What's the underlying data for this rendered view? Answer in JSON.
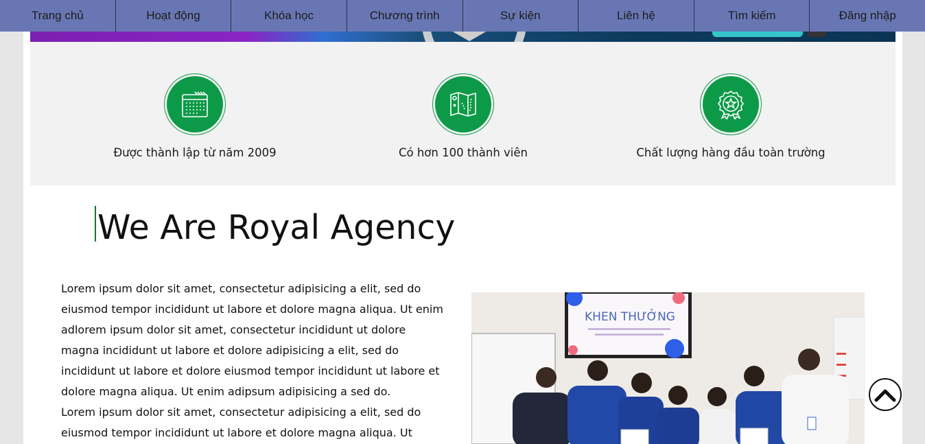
{
  "nav": {
    "items": [
      {
        "label": "Trang chủ"
      },
      {
        "label": "Hoạt động"
      },
      {
        "label": "Khóa học"
      },
      {
        "label": "Chương trình"
      },
      {
        "label": "Sự kiện"
      },
      {
        "label": "Liên hệ"
      },
      {
        "label": "Tìm kiếm"
      },
      {
        "label": "Đăng nhập"
      }
    ]
  },
  "features": [
    {
      "icon": "calendar-icon",
      "label": "Được thành lập từ năm 2009"
    },
    {
      "icon": "map-icon",
      "label": "Có hơn 100 thành viên"
    },
    {
      "icon": "award-icon",
      "label": "Chất lượng hàng đầu toàn trường"
    }
  ],
  "about": {
    "heading": "We Are Royal Agency",
    "paragraphs": [
      "Lorem ipsum dolor sit amet, consectetur adipisicing a elit, sed do eiusmod tempor incididunt ut labore et dolore magna aliqua. Ut enim adlorem ipsum dolor sit amet, consectetur incididunt ut dolore magna incididunt ut labore et dolore adipisicing a elit, sed do incididunt ut labore et dolore eiusmod tempor incididunt ut labore et dolore magna aliqua. Ut enim adipsum adipisicing a sed do.",
      "Lorem ipsum dolor sit amet, consectetur adipisicing a elit, sed do eiusmod tempor incididunt ut labore et dolore magna aliqua. Ut"
    ]
  },
  "photo": {
    "screen_text": "KHEN THƯỞNG"
  },
  "colors": {
    "nav_bg": "#6877b4",
    "accent_green": "#0d9a48",
    "features_bg": "#f2f2f2"
  },
  "back_to_top": {
    "icon": "chevron-up-icon"
  }
}
